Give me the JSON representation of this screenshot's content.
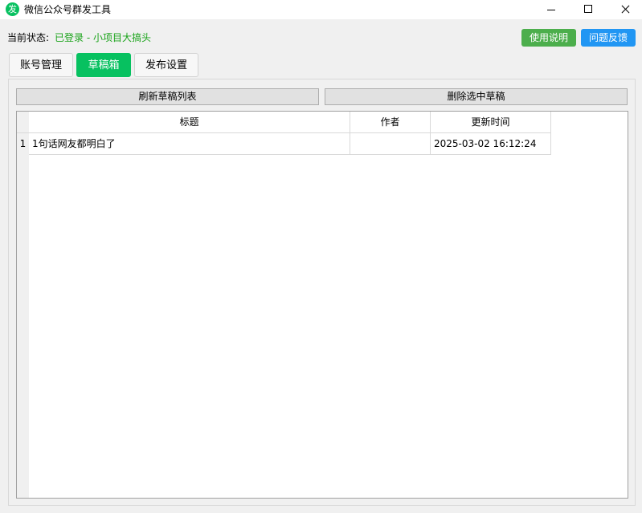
{
  "window": {
    "icon_glyph": "发",
    "title": "微信公众号群发工具"
  },
  "status": {
    "label": "当前状态:",
    "value": "已登录 - 小项目大搞头",
    "value_color": "#1aa31a"
  },
  "help_buttons": {
    "usage": "使用说明",
    "feedback": "问题反馈"
  },
  "tabs": [
    {
      "label": "账号管理",
      "active": false
    },
    {
      "label": "草稿箱",
      "active": true
    },
    {
      "label": "发布设置",
      "active": false
    }
  ],
  "actions": {
    "refresh": "刷新草稿列表",
    "delete": "删除选中草稿"
  },
  "table": {
    "columns": [
      "标题",
      "作者",
      "更新时间"
    ],
    "rows": [
      {
        "num": "1",
        "title": "1句话网友都明白了",
        "author": "",
        "updated": "2025-03-02 16:12:24"
      }
    ]
  },
  "colors": {
    "accent": "#07c160",
    "usage_button": "#4cae4c",
    "feedback_button": "#2196f3"
  }
}
